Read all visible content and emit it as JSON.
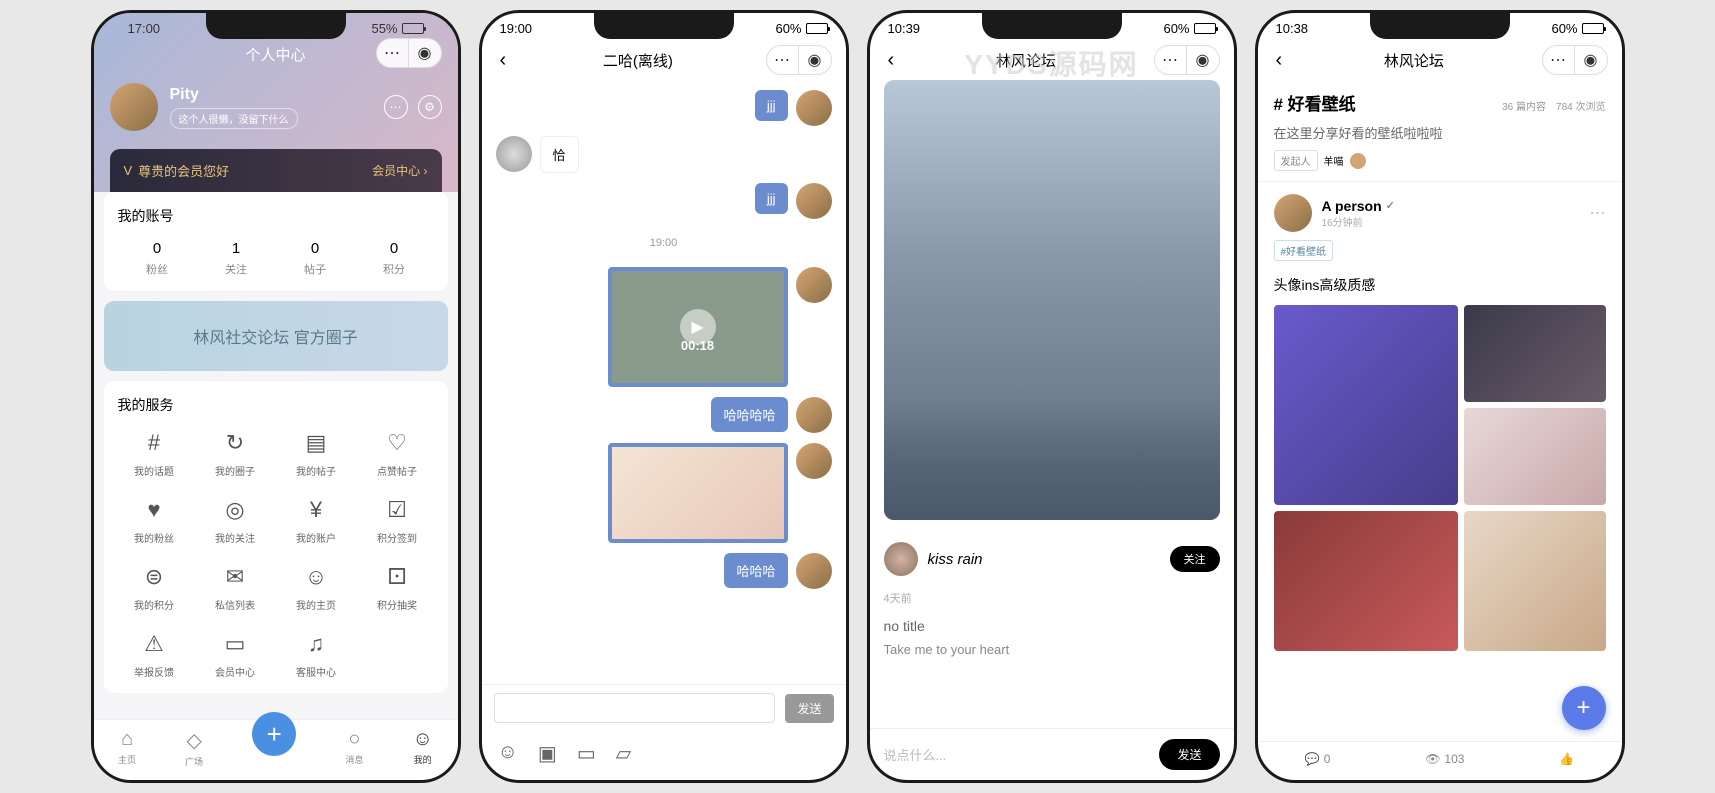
{
  "watermark": "YYDS源码网",
  "phone1": {
    "time": "17:00",
    "battery": "55%",
    "title": "个人中心",
    "user": {
      "name": "Pity",
      "bio": "这个人很懒，没留下什么"
    },
    "vip": {
      "greeting": "尊贵的会员您好",
      "link": "会员中心"
    },
    "account_title": "我的账号",
    "stats": [
      {
        "value": "0",
        "label": "粉丝"
      },
      {
        "value": "1",
        "label": "关注"
      },
      {
        "value": "0",
        "label": "帖子"
      },
      {
        "value": "0",
        "label": "积分"
      }
    ],
    "banner": "林风社交论坛 官方圈子",
    "services_title": "我的服务",
    "services": [
      {
        "icon": "#",
        "label": "我的话题"
      },
      {
        "icon": "↻",
        "label": "我的圈子"
      },
      {
        "icon": "▤",
        "label": "我的帖子"
      },
      {
        "icon": "♡",
        "label": "点赞帖子"
      },
      {
        "icon": "♥",
        "label": "我的粉丝"
      },
      {
        "icon": "◎",
        "label": "我的关注"
      },
      {
        "icon": "¥",
        "label": "我的账户"
      },
      {
        "icon": "☑",
        "label": "积分签到"
      },
      {
        "icon": "⊜",
        "label": "我的积分"
      },
      {
        "icon": "✉",
        "label": "私信列表"
      },
      {
        "icon": "☺",
        "label": "我的主页"
      },
      {
        "icon": "⚀",
        "label": "积分抽奖"
      },
      {
        "icon": "⚠",
        "label": "举报反馈"
      },
      {
        "icon": "▭",
        "label": "会员中心"
      },
      {
        "icon": "♫",
        "label": "客服中心"
      }
    ],
    "tabs": [
      {
        "icon": "⌂",
        "label": "主页"
      },
      {
        "icon": "◇",
        "label": "广场"
      },
      {
        "icon": "+",
        "label": ""
      },
      {
        "icon": "○",
        "label": "消息"
      },
      {
        "icon": "☺",
        "label": "我的"
      }
    ]
  },
  "phone2": {
    "time": "19:00",
    "battery": "60%",
    "title": "二哈(离线)",
    "messages": [
      {
        "side": "right",
        "type": "text",
        "text": "jjj"
      },
      {
        "side": "left",
        "type": "text",
        "text": "恰"
      },
      {
        "side": "right",
        "type": "text",
        "text": "jjj"
      },
      {
        "side": "center",
        "type": "timestamp",
        "text": "19:00"
      },
      {
        "side": "right",
        "type": "video",
        "duration": "00:18"
      },
      {
        "side": "right",
        "type": "text",
        "text": "哈哈哈哈"
      },
      {
        "side": "right",
        "type": "image",
        "text": ""
      },
      {
        "side": "right",
        "type": "text",
        "text": "哈哈哈"
      }
    ],
    "send": "发送"
  },
  "phone3": {
    "time": "10:39",
    "battery": "60%",
    "title": "林风论坛",
    "author": "kiss rain",
    "follow": "关注",
    "post_time": "4天前",
    "post_title": "no title",
    "post_sub": "Take me to your heart",
    "input_placeholder": "说点什么...",
    "send": "发送"
  },
  "phone4": {
    "time": "10:38",
    "battery": "60%",
    "title": "林风论坛",
    "topic": "# 好看壁纸",
    "stats": "36 篇内容　784 次浏览",
    "desc": "在这里分享好看的壁纸啦啦啦",
    "publisher_tag": "发起人",
    "publisher_name": "羊喵",
    "post": {
      "author": "A person",
      "time": "16分钟前",
      "tag": "#好看壁纸",
      "title": "头像ins高级质感"
    },
    "footer": {
      "comments": "0",
      "views": "103",
      "like": ""
    }
  }
}
